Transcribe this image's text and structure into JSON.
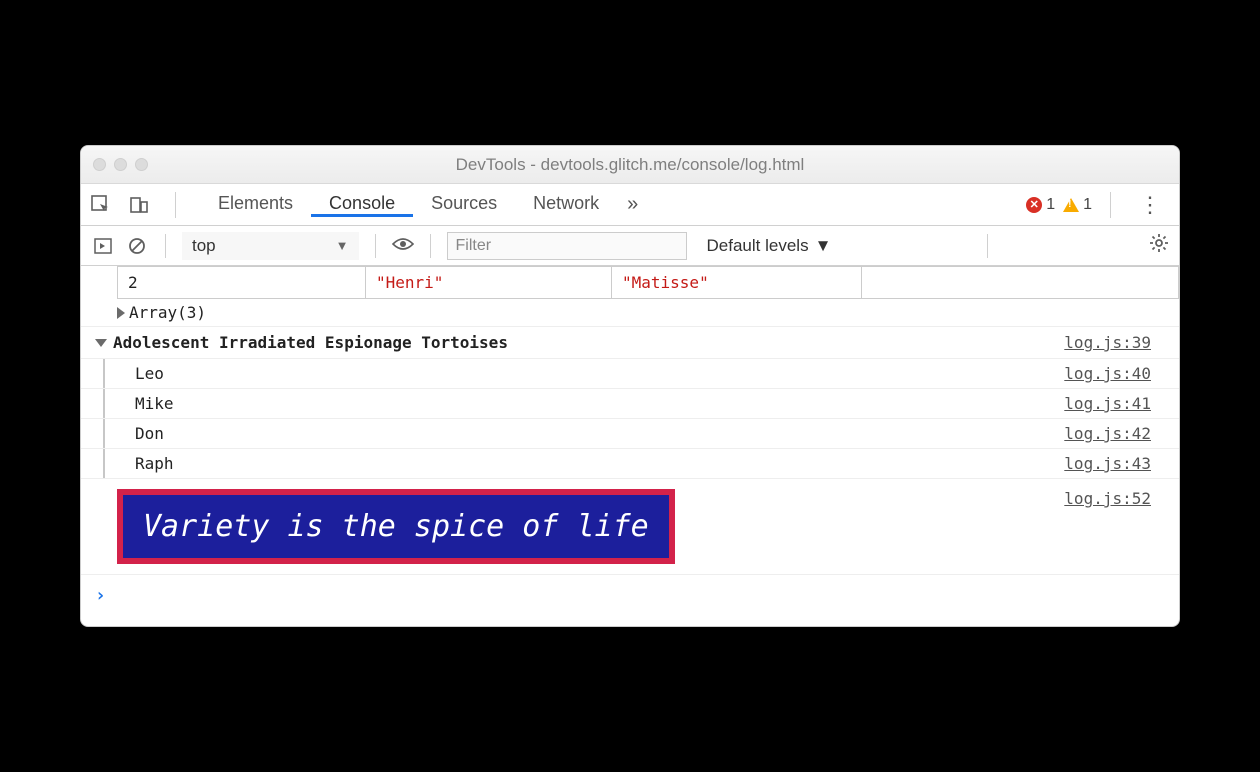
{
  "window": {
    "title": "DevTools - devtools.glitch.me/console/log.html"
  },
  "tabs": {
    "elements": "Elements",
    "console": "Console",
    "sources": "Sources",
    "network": "Network",
    "more": "»"
  },
  "badges": {
    "error_count": "1",
    "warn_count": "1"
  },
  "toolbar": {
    "context": "top",
    "filter_placeholder": "Filter",
    "levels": "Default levels"
  },
  "table": {
    "index": "2",
    "col1": "\"Henri\"",
    "col2": "\"Matisse\""
  },
  "array_line": "Array(3)",
  "group": {
    "title": "Adolescent Irradiated Espionage Tortoises",
    "src": "log.js:39",
    "items": [
      {
        "text": "Leo",
        "src": "log.js:40"
      },
      {
        "text": "Mike",
        "src": "log.js:41"
      },
      {
        "text": "Don",
        "src": "log.js:42"
      },
      {
        "text": "Raph",
        "src": "log.js:43"
      }
    ]
  },
  "styled": {
    "text": "Variety is the spice of life",
    "src": "log.js:52"
  },
  "prompt": "›"
}
